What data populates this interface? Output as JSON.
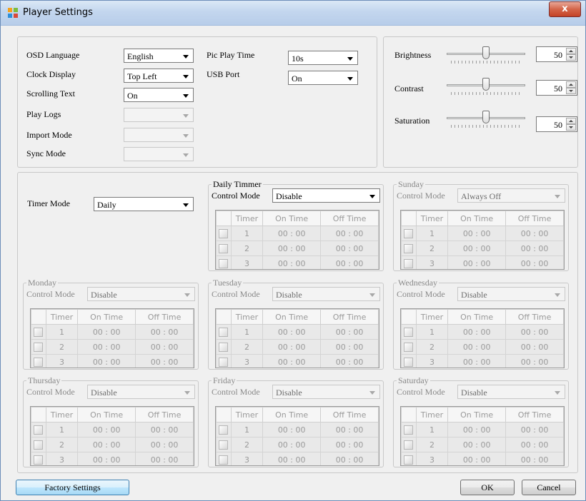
{
  "window": {
    "title": "Player Settings",
    "close_label": "x",
    "icon": "app-logo-icon"
  },
  "general": {
    "osd_language": {
      "label": "OSD Language",
      "value": "English"
    },
    "clock_display": {
      "label": "Clock Display",
      "value": "Top Left"
    },
    "scrolling_text": {
      "label": "Scrolling Text",
      "value": "On"
    },
    "play_logs": {
      "label": "Play Logs",
      "value": ""
    },
    "import_mode": {
      "label": "Import Mode",
      "value": ""
    },
    "sync_mode": {
      "label": "Sync Mode",
      "value": ""
    },
    "pic_play_time": {
      "label": "Pic Play Time",
      "value": "10s"
    },
    "usb_port": {
      "label": "USB Port",
      "value": "On"
    }
  },
  "picture": {
    "brightness": {
      "label": "Brightness",
      "value": "50",
      "level": 0.5
    },
    "contrast": {
      "label": "Contrast",
      "value": "50",
      "level": 0.5
    },
    "saturation": {
      "label": "Saturation",
      "value": "50",
      "level": 0.5
    }
  },
  "timer": {
    "mode_label": "Timer Mode",
    "mode_value": "Daily",
    "control_mode_label": "Control Mode",
    "columns": {
      "timer": "Timer",
      "on": "On Time",
      "off": "Off Time"
    },
    "rows": [
      {
        "n": "1",
        "on": "00 : 00",
        "off": "00 : 00"
      },
      {
        "n": "2",
        "on": "00 : 00",
        "off": "00 : 00"
      },
      {
        "n": "3",
        "on": "00 : 00",
        "off": "00 : 00"
      }
    ],
    "boxes": {
      "daily": {
        "title": "Daily Timmer",
        "control": "Disable"
      },
      "sunday": {
        "title": "Sunday",
        "control": "Always Off"
      },
      "monday": {
        "title": "Monday",
        "control": "Disable"
      },
      "tuesday": {
        "title": "Tuesday",
        "control": "Disable"
      },
      "wednesday": {
        "title": "Wednesday",
        "control": "Disable"
      },
      "thursday": {
        "title": "Thursday",
        "control": "Disable"
      },
      "friday": {
        "title": "Friday",
        "control": "Disable"
      },
      "saturday": {
        "title": "Saturday",
        "control": "Disable"
      }
    }
  },
  "footer": {
    "factory": "Factory Settings",
    "ok": "OK",
    "cancel": "Cancel"
  }
}
